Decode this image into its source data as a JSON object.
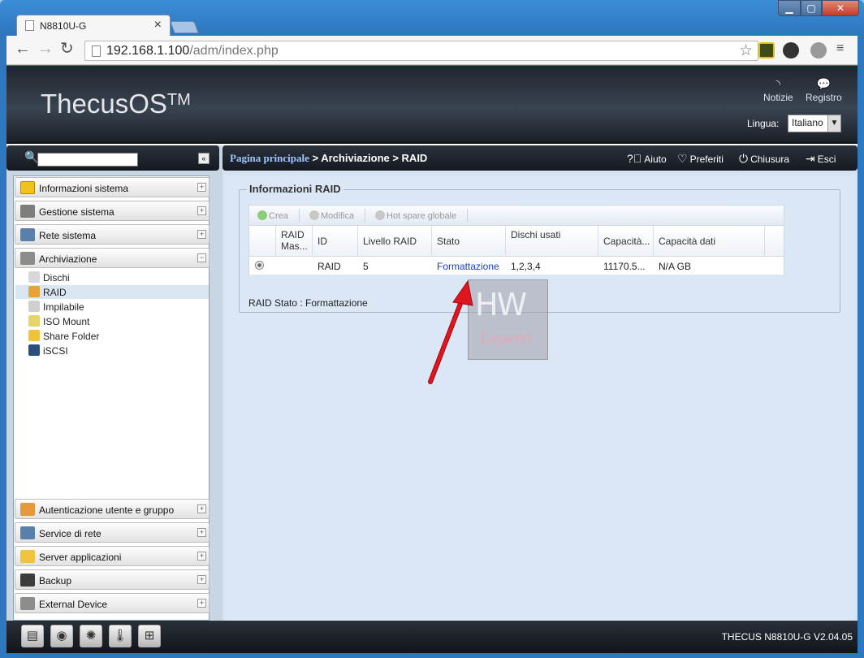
{
  "browser": {
    "tab_title": "N8810U-G",
    "tab_close": "×",
    "url_host": "192.168.1.100",
    "url_path": "/adm/index.php",
    "win_min": "▁",
    "win_max": "▢",
    "win_close": "✕"
  },
  "header": {
    "logo": "ThecusOS",
    "logo_tm": "TM",
    "notizie": "Notizie",
    "registro": "Registro",
    "lingua_label": "Lingua:",
    "lingua_value": "Italiano"
  },
  "sidebar": {
    "top_items": [
      {
        "label": "Informazioni sistema",
        "expander": "+"
      },
      {
        "label": "Gestione sistema",
        "expander": "+"
      },
      {
        "label": "Rete sistema",
        "expander": "+"
      },
      {
        "label": "Archiviazione",
        "expander": "−"
      }
    ],
    "sub_items": [
      {
        "label": "Dischi"
      },
      {
        "label": "RAID"
      },
      {
        "label": "Impilabile"
      },
      {
        "label": "ISO Mount"
      },
      {
        "label": "Share Folder"
      },
      {
        "label": "iSCSI"
      }
    ],
    "bottom_items": [
      {
        "label": "Autenticazione utente e gruppo",
        "expander": "+"
      },
      {
        "label": "Service di rete",
        "expander": "+"
      },
      {
        "label": "Server applicazioni",
        "expander": "+"
      },
      {
        "label": "Backup",
        "expander": "+"
      },
      {
        "label": "External Device",
        "expander": "+"
      }
    ]
  },
  "breadcrumb": {
    "home": "Pagina principale",
    "rest": " > Archiviazione > RAID"
  },
  "toplinks": {
    "aiuto": "Aiuto",
    "preferiti": "Preferiti",
    "chiusura": "Chiusura",
    "esci": "Esci"
  },
  "panel": {
    "title": "Informazioni RAID",
    "toolbar": {
      "crea": "Crea",
      "modifica": "Modifica",
      "hot_spare": "Hot spare globale"
    },
    "columns": {
      "raid_master": "RAID Mas...",
      "id": "ID",
      "livello": "Livello RAID",
      "stato": "Stato",
      "dischi_usati": "Dischi usati",
      "capacita": "Capacità...",
      "capacita_dati": "Capacità dati"
    },
    "row": {
      "id": "RAID",
      "livello": "5",
      "stato": "Formattazione",
      "dischi": "1,2,3,4",
      "capacita": "11170.5...",
      "capacita_dati": "N/A GB"
    },
    "status_text": "RAID Stato : Formattazione"
  },
  "watermark": {
    "line1": "HW",
    "line2": "Legend"
  },
  "footer": {
    "version": "THECUS N8810U-G V2.04.05"
  },
  "colors": {
    "accent_link": "#1a3fb3",
    "arrow": "#e0151f"
  }
}
